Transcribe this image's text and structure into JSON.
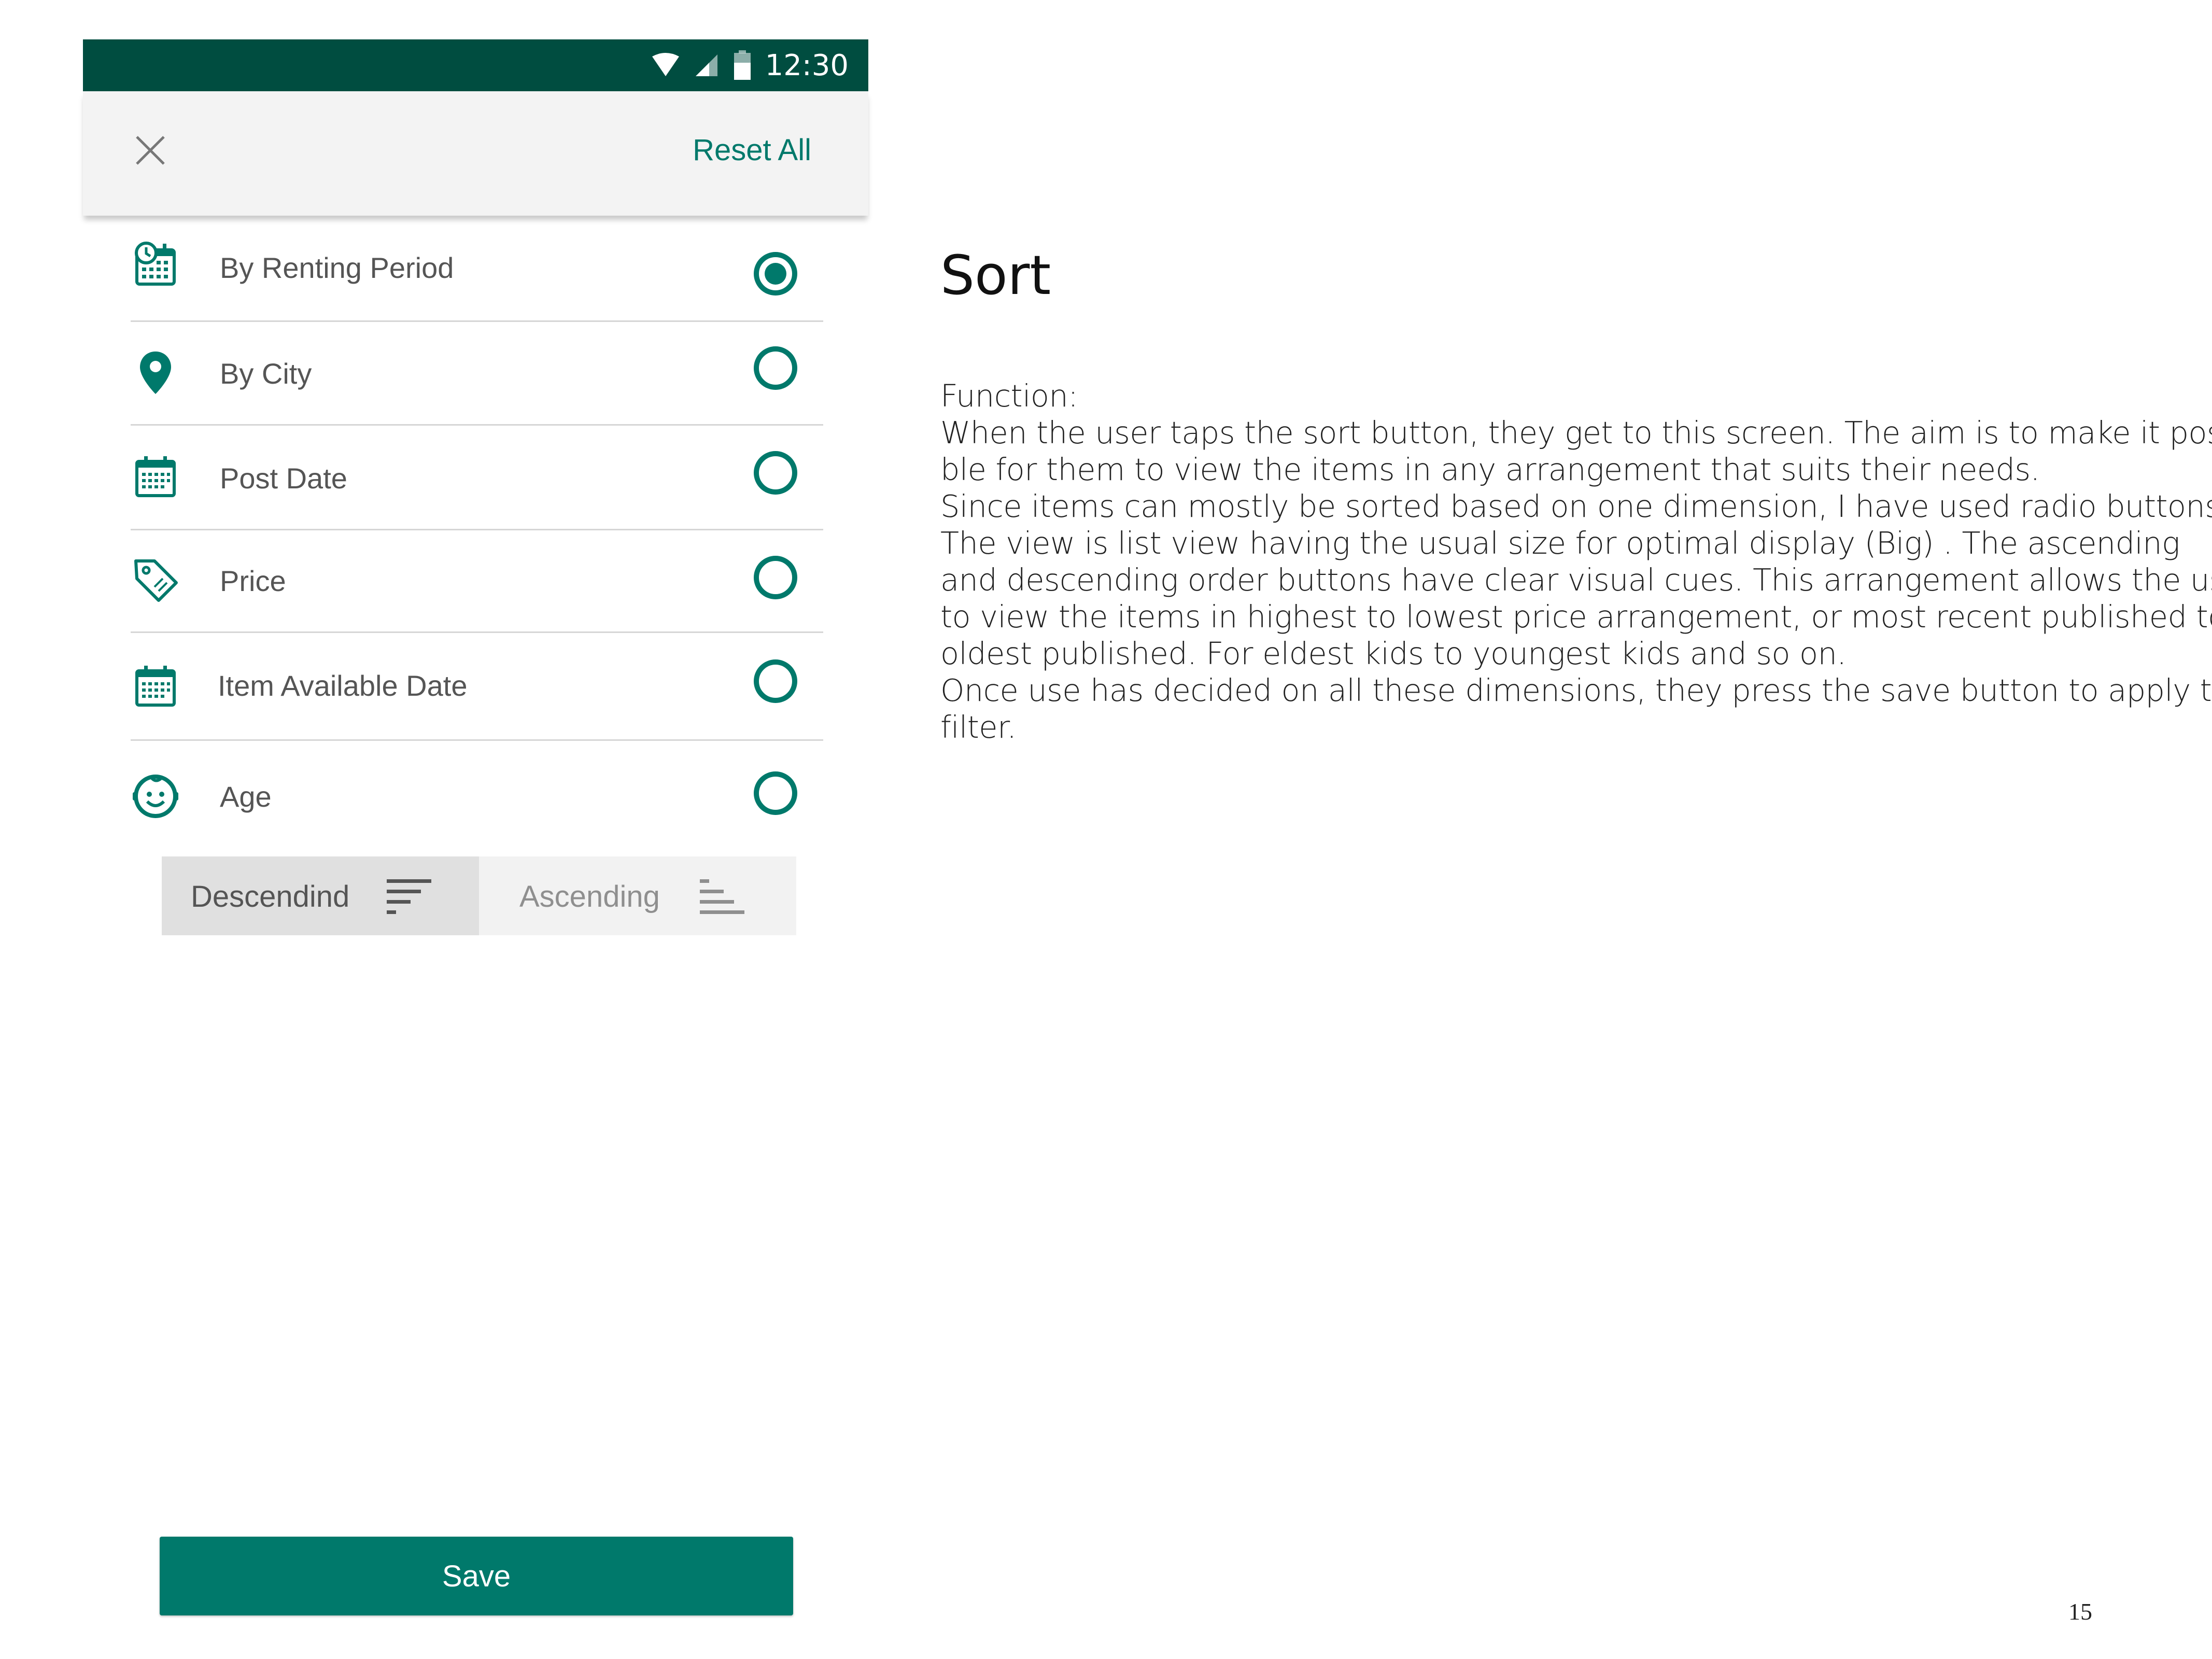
{
  "status_bar": {
    "time": "12:30",
    "icons": [
      "wifi-icon",
      "cell-signal-icon",
      "battery-icon"
    ],
    "color": "#004d40"
  },
  "app_bar": {
    "close_icon": "close-icon",
    "reset_label": "Reset All"
  },
  "sort_options": [
    {
      "label": "By Renting Period",
      "icon": "calendar-clock-icon",
      "selected": true
    },
    {
      "label": "By City",
      "icon": "location-pin-icon",
      "selected": false
    },
    {
      "label": "Post Date",
      "icon": "calendar-icon",
      "selected": false
    },
    {
      "label": "Price",
      "icon": "price-tag-icon",
      "selected": false
    },
    {
      "label": "Item Available Date",
      "icon": "calendar-icon",
      "selected": false
    },
    {
      "label": "Age",
      "icon": "baby-face-icon",
      "selected": false
    }
  ],
  "order_toggle": {
    "descending_label": "Descendind",
    "ascending_label": "Ascending",
    "selected": "descending"
  },
  "save_label": "Save",
  "description": {
    "title": "Sort",
    "lines": [
      "Function:",
      "When the user taps the sort button, they get to this screen. The aim is to make it possi-",
      "ble for them to view the items in any arrangement that suits their needs.",
      "Since items can mostly be sorted based on one dimension, I have used radio buttons.",
      "The view is  list view having the usual size for optimal display  (Big) . The ascending",
      "and descending order buttons have clear visual cues. This arrangement allows the user",
      "to view the items in highest to lowest price arrangement, or most recent published to",
      "oldest published. For eldest kids to youngest kids and so on.",
      "Once use has decided on all these dimensions, they press the save button to apply the",
      "filter."
    ]
  },
  "page_number": "15",
  "colors": {
    "accent": "#00796b",
    "status_bar": "#004d40",
    "app_bar": "#f3f3f3"
  }
}
